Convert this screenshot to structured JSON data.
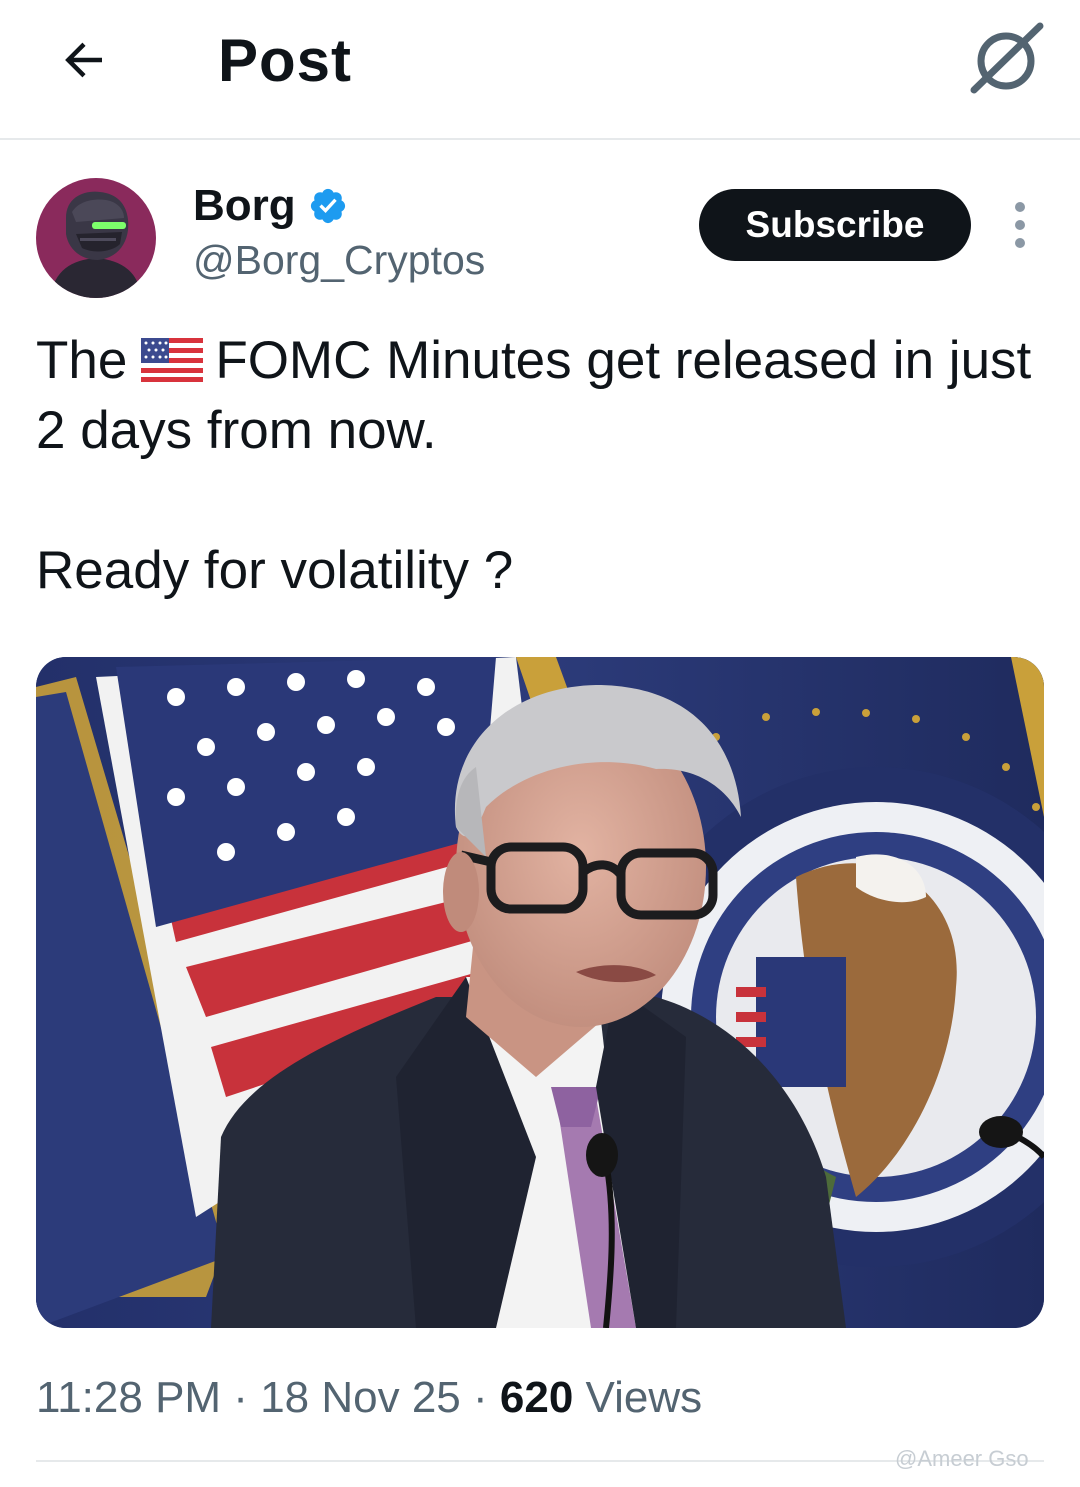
{
  "header": {
    "title": "Post"
  },
  "author": {
    "display_name": "Borg",
    "handle": "@Borg_Cryptos"
  },
  "actions": {
    "subscribe_label": "Subscribe"
  },
  "post": {
    "text_part1": "The",
    "flag_emoji_name": "us-flag-icon",
    "text_part2": "FOMC Minutes get released in just 2 days from now.",
    "text_line3": "Ready for volatility ?"
  },
  "meta": {
    "time": "11:28 PM",
    "sep1": " · ",
    "date": "18 Nov 25",
    "sep2": " · ",
    "views_count": "620",
    "views_label": " Views"
  },
  "watermark": "@Ameer Gso",
  "colors": {
    "accent_verified": "#1d9bf0",
    "text_primary": "#0f1419",
    "text_secondary": "#536471",
    "button_dark": "#0f1419"
  }
}
